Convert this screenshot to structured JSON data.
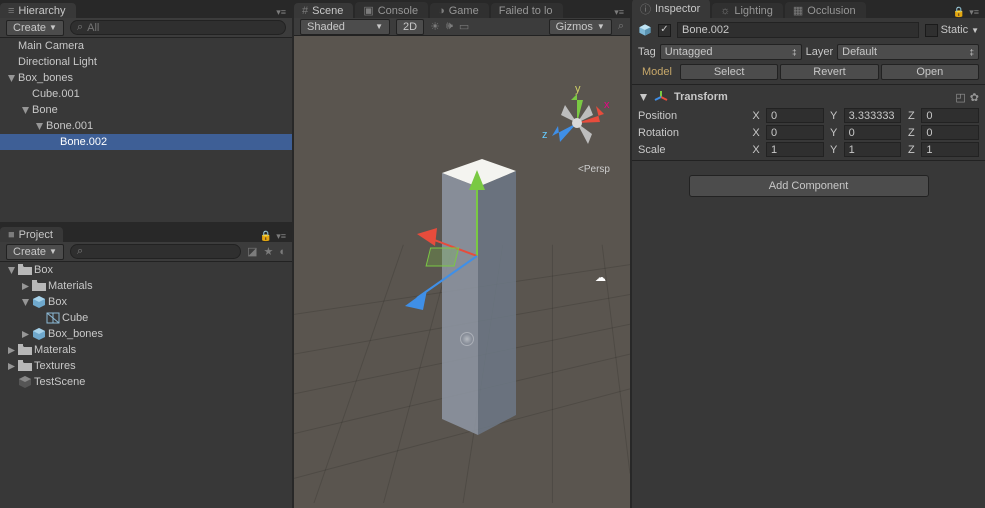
{
  "hierarchy": {
    "tab": "Hierarchy",
    "create": "Create",
    "search_placeholder": "All",
    "items": [
      {
        "name": "Main Camera",
        "depth": 0,
        "fold": ""
      },
      {
        "name": "Directional Light",
        "depth": 0,
        "fold": ""
      },
      {
        "name": "Box_bones",
        "depth": 0,
        "fold": "open"
      },
      {
        "name": "Cube.001",
        "depth": 1,
        "fold": ""
      },
      {
        "name": "Bone",
        "depth": 1,
        "fold": "open"
      },
      {
        "name": "Bone.001",
        "depth": 2,
        "fold": "open"
      },
      {
        "name": "Bone.002",
        "depth": 3,
        "fold": "",
        "selected": true
      }
    ]
  },
  "project": {
    "tab": "Project",
    "create": "Create",
    "items": [
      {
        "name": "Box",
        "depth": 0,
        "fold": "open",
        "icon": "folder"
      },
      {
        "name": "Materials",
        "depth": 1,
        "fold": "closed",
        "icon": "folder"
      },
      {
        "name": "Box",
        "depth": 1,
        "fold": "open",
        "icon": "prefab"
      },
      {
        "name": "Cube",
        "depth": 2,
        "fold": "",
        "icon": "mesh"
      },
      {
        "name": "Box_bones",
        "depth": 1,
        "fold": "closed",
        "icon": "prefab"
      },
      {
        "name": "Materals",
        "depth": 0,
        "fold": "closed",
        "icon": "folder"
      },
      {
        "name": "Textures",
        "depth": 0,
        "fold": "closed",
        "icon": "folder"
      },
      {
        "name": "TestScene",
        "depth": 0,
        "fold": "",
        "icon": "scene"
      }
    ]
  },
  "scene": {
    "tabs": [
      "Scene",
      "Console",
      "Game",
      "Failed to lo"
    ],
    "shading": "Shaded",
    "mode2d": "2D",
    "gizmos": "Gizmos",
    "persp": "<Persp",
    "axis": {
      "x": "x",
      "y": "y",
      "z": "z"
    }
  },
  "inspector": {
    "tabs": [
      "Inspector",
      "Lighting",
      "Occlusion"
    ],
    "name": "Bone.002",
    "enabled": true,
    "static_label": "Static",
    "tag_label": "Tag",
    "tag_value": "Untagged",
    "layer_label": "Layer",
    "layer_value": "Default",
    "model_label": "Model",
    "model_buttons": [
      "Select",
      "Revert",
      "Open"
    ],
    "transform": {
      "title": "Transform",
      "rows": [
        {
          "label": "Position",
          "x": "0",
          "y": "3.333333",
          "z": "0"
        },
        {
          "label": "Rotation",
          "x": "0",
          "y": "0",
          "z": "0"
        },
        {
          "label": "Scale",
          "x": "1",
          "y": "1",
          "z": "1"
        }
      ]
    },
    "add_component": "Add Component"
  },
  "icons": {
    "hierarchy": "≡",
    "project": "■",
    "scene": "#",
    "console": "▣",
    "game": "◑",
    "inspector": "ⓘ",
    "lighting": "☼",
    "occlusion": "▦",
    "lock": "🔒",
    "menu": "▾",
    "search": "⌕",
    "star": "★"
  },
  "colors": {
    "x": "#e74c3c",
    "y": "#7ac943",
    "z": "#3f8fe7",
    "accent": "#3e5f96"
  }
}
